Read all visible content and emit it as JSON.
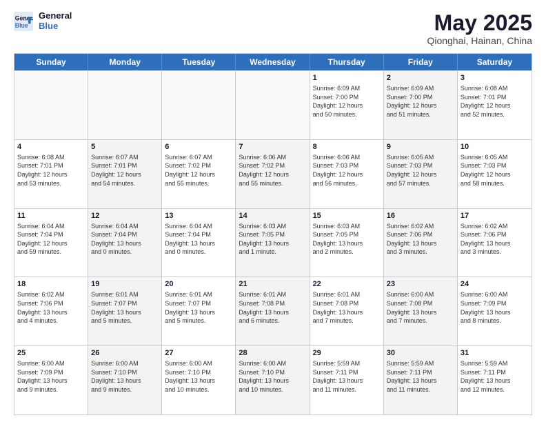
{
  "header": {
    "logo_line1": "General",
    "logo_line2": "Blue",
    "month": "May 2025",
    "location": "Qionghai, Hainan, China"
  },
  "weekdays": [
    "Sunday",
    "Monday",
    "Tuesday",
    "Wednesday",
    "Thursday",
    "Friday",
    "Saturday"
  ],
  "rows": [
    [
      {
        "day": "",
        "info": "",
        "shaded": true
      },
      {
        "day": "",
        "info": "",
        "shaded": true
      },
      {
        "day": "",
        "info": "",
        "shaded": true
      },
      {
        "day": "",
        "info": "",
        "shaded": true
      },
      {
        "day": "1",
        "info": "Sunrise: 6:09 AM\nSunset: 7:00 PM\nDaylight: 12 hours\nand 50 minutes.",
        "shaded": false
      },
      {
        "day": "2",
        "info": "Sunrise: 6:09 AM\nSunset: 7:00 PM\nDaylight: 12 hours\nand 51 minutes.",
        "shaded": true
      },
      {
        "day": "3",
        "info": "Sunrise: 6:08 AM\nSunset: 7:01 PM\nDaylight: 12 hours\nand 52 minutes.",
        "shaded": false
      }
    ],
    [
      {
        "day": "4",
        "info": "Sunrise: 6:08 AM\nSunset: 7:01 PM\nDaylight: 12 hours\nand 53 minutes.",
        "shaded": false
      },
      {
        "day": "5",
        "info": "Sunrise: 6:07 AM\nSunset: 7:01 PM\nDaylight: 12 hours\nand 54 minutes.",
        "shaded": true
      },
      {
        "day": "6",
        "info": "Sunrise: 6:07 AM\nSunset: 7:02 PM\nDaylight: 12 hours\nand 55 minutes.",
        "shaded": false
      },
      {
        "day": "7",
        "info": "Sunrise: 6:06 AM\nSunset: 7:02 PM\nDaylight: 12 hours\nand 55 minutes.",
        "shaded": true
      },
      {
        "day": "8",
        "info": "Sunrise: 6:06 AM\nSunset: 7:03 PM\nDaylight: 12 hours\nand 56 minutes.",
        "shaded": false
      },
      {
        "day": "9",
        "info": "Sunrise: 6:05 AM\nSunset: 7:03 PM\nDaylight: 12 hours\nand 57 minutes.",
        "shaded": true
      },
      {
        "day": "10",
        "info": "Sunrise: 6:05 AM\nSunset: 7:03 PM\nDaylight: 12 hours\nand 58 minutes.",
        "shaded": false
      }
    ],
    [
      {
        "day": "11",
        "info": "Sunrise: 6:04 AM\nSunset: 7:04 PM\nDaylight: 12 hours\nand 59 minutes.",
        "shaded": false
      },
      {
        "day": "12",
        "info": "Sunrise: 6:04 AM\nSunset: 7:04 PM\nDaylight: 13 hours\nand 0 minutes.",
        "shaded": true
      },
      {
        "day": "13",
        "info": "Sunrise: 6:04 AM\nSunset: 7:04 PM\nDaylight: 13 hours\nand 0 minutes.",
        "shaded": false
      },
      {
        "day": "14",
        "info": "Sunrise: 6:03 AM\nSunset: 7:05 PM\nDaylight: 13 hours\nand 1 minute.",
        "shaded": true
      },
      {
        "day": "15",
        "info": "Sunrise: 6:03 AM\nSunset: 7:05 PM\nDaylight: 13 hours\nand 2 minutes.",
        "shaded": false
      },
      {
        "day": "16",
        "info": "Sunrise: 6:02 AM\nSunset: 7:06 PM\nDaylight: 13 hours\nand 3 minutes.",
        "shaded": true
      },
      {
        "day": "17",
        "info": "Sunrise: 6:02 AM\nSunset: 7:06 PM\nDaylight: 13 hours\nand 3 minutes.",
        "shaded": false
      }
    ],
    [
      {
        "day": "18",
        "info": "Sunrise: 6:02 AM\nSunset: 7:06 PM\nDaylight: 13 hours\nand 4 minutes.",
        "shaded": false
      },
      {
        "day": "19",
        "info": "Sunrise: 6:01 AM\nSunset: 7:07 PM\nDaylight: 13 hours\nand 5 minutes.",
        "shaded": true
      },
      {
        "day": "20",
        "info": "Sunrise: 6:01 AM\nSunset: 7:07 PM\nDaylight: 13 hours\nand 5 minutes.",
        "shaded": false
      },
      {
        "day": "21",
        "info": "Sunrise: 6:01 AM\nSunset: 7:08 PM\nDaylight: 13 hours\nand 6 minutes.",
        "shaded": true
      },
      {
        "day": "22",
        "info": "Sunrise: 6:01 AM\nSunset: 7:08 PM\nDaylight: 13 hours\nand 7 minutes.",
        "shaded": false
      },
      {
        "day": "23",
        "info": "Sunrise: 6:00 AM\nSunset: 7:08 PM\nDaylight: 13 hours\nand 7 minutes.",
        "shaded": true
      },
      {
        "day": "24",
        "info": "Sunrise: 6:00 AM\nSunset: 7:09 PM\nDaylight: 13 hours\nand 8 minutes.",
        "shaded": false
      }
    ],
    [
      {
        "day": "25",
        "info": "Sunrise: 6:00 AM\nSunset: 7:09 PM\nDaylight: 13 hours\nand 9 minutes.",
        "shaded": false
      },
      {
        "day": "26",
        "info": "Sunrise: 6:00 AM\nSunset: 7:10 PM\nDaylight: 13 hours\nand 9 minutes.",
        "shaded": true
      },
      {
        "day": "27",
        "info": "Sunrise: 6:00 AM\nSunset: 7:10 PM\nDaylight: 13 hours\nand 10 minutes.",
        "shaded": false
      },
      {
        "day": "28",
        "info": "Sunrise: 6:00 AM\nSunset: 7:10 PM\nDaylight: 13 hours\nand 10 minutes.",
        "shaded": true
      },
      {
        "day": "29",
        "info": "Sunrise: 5:59 AM\nSunset: 7:11 PM\nDaylight: 13 hours\nand 11 minutes.",
        "shaded": false
      },
      {
        "day": "30",
        "info": "Sunrise: 5:59 AM\nSunset: 7:11 PM\nDaylight: 13 hours\nand 11 minutes.",
        "shaded": true
      },
      {
        "day": "31",
        "info": "Sunrise: 5:59 AM\nSunset: 7:11 PM\nDaylight: 13 hours\nand 12 minutes.",
        "shaded": false
      }
    ]
  ]
}
